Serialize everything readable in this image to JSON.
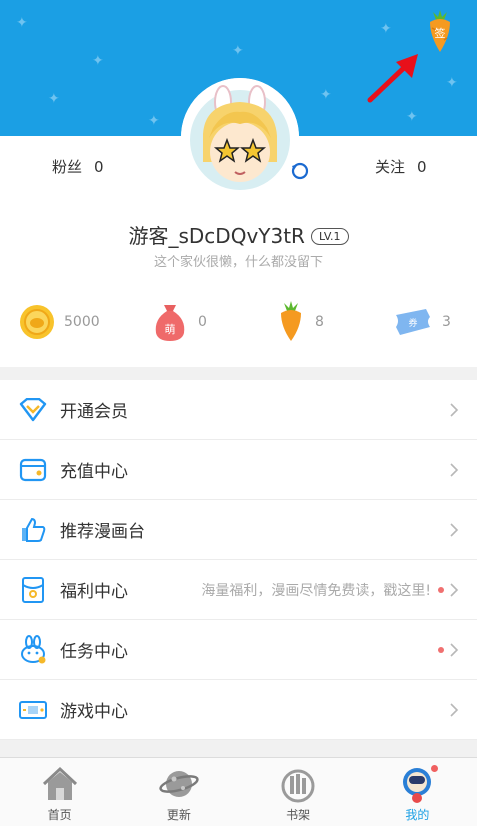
{
  "header": {
    "checkin_icon": "carrot-checkin-icon",
    "checkin_badge": "签"
  },
  "profile": {
    "fans_label": "粉丝",
    "fans_count": "0",
    "follow_label": "关注",
    "follow_count": "0",
    "username": "游客_sDcDQvY3tR",
    "level": "LV.1",
    "bio": "这个家伙很懒，什么都没留下"
  },
  "stats": [
    {
      "icon": "coin-icon",
      "value": "5000"
    },
    {
      "icon": "money-bag-icon",
      "value": "0",
      "badge": "萌"
    },
    {
      "icon": "carrot-icon",
      "value": "8"
    },
    {
      "icon": "ticket-icon",
      "value": "3",
      "badge": "券"
    }
  ],
  "menu": [
    {
      "label": "开通会员",
      "icon": "vip-diamond-icon"
    },
    {
      "label": "充值中心",
      "icon": "wallet-icon"
    },
    {
      "label": "推荐漫画台",
      "icon": "thumbs-up-icon"
    },
    {
      "label": "福利中心",
      "icon": "gift-card-icon",
      "hint": "海量福利，漫画尽情免费读，戳这里!",
      "has_dot": true
    },
    {
      "label": "任务中心",
      "icon": "bunny-icon",
      "has_dot": true
    },
    {
      "label": "游戏中心",
      "icon": "gamepad-icon"
    }
  ],
  "tabbar": [
    {
      "label": "首页",
      "icon": "house-icon"
    },
    {
      "label": "更新",
      "icon": "planet-icon"
    },
    {
      "label": "书架",
      "icon": "bookshelf-icon"
    },
    {
      "label": "我的",
      "icon": "astronaut-icon",
      "active": true,
      "has_dot": true
    }
  ],
  "colors": {
    "brand_blue": "#1b9fe4",
    "dot_red": "#f07070",
    "annotation_arrow": "#e8101a"
  }
}
